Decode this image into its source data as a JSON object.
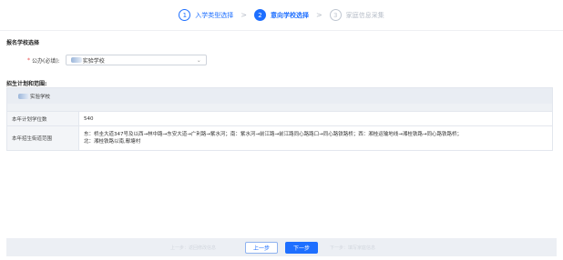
{
  "stepper": {
    "steps": [
      {
        "num": "1",
        "label": "入学类型选择",
        "state": "done"
      },
      {
        "num": "2",
        "label": "意向学校选择",
        "state": "active"
      },
      {
        "num": "3",
        "label": "家庭信息采集",
        "state": "todo"
      }
    ],
    "separator": ">"
  },
  "school_section": {
    "title": "报名学校选择",
    "field_required_mark": "*",
    "field_label": "公办(必填):",
    "selected_value": "实验学校"
  },
  "plan_section": {
    "title": "招生计划和范围:",
    "school_name": "实验学校",
    "rows": [
      {
        "key": "本年计划学位数",
        "value": "540"
      },
      {
        "key": "本年招生街道范围",
        "value_lines": [
          "东：桥圭大道347号及以西→林中路→东安大道→广利路→紫水河；南：紫水河→前江路→前江路同心路路口→同心路铁路桥；西：湘桂运输地线→湘桂铁路→同心路铁路桥；",
          "北：湘桂铁路以南,鄢塘村"
        ]
      }
    ]
  },
  "bottom": {
    "hint_left": "上一步：返回修改信息",
    "hint_right": "下一步：填写家庭信息",
    "prev_label": "上一步",
    "next_label": "下一步"
  }
}
